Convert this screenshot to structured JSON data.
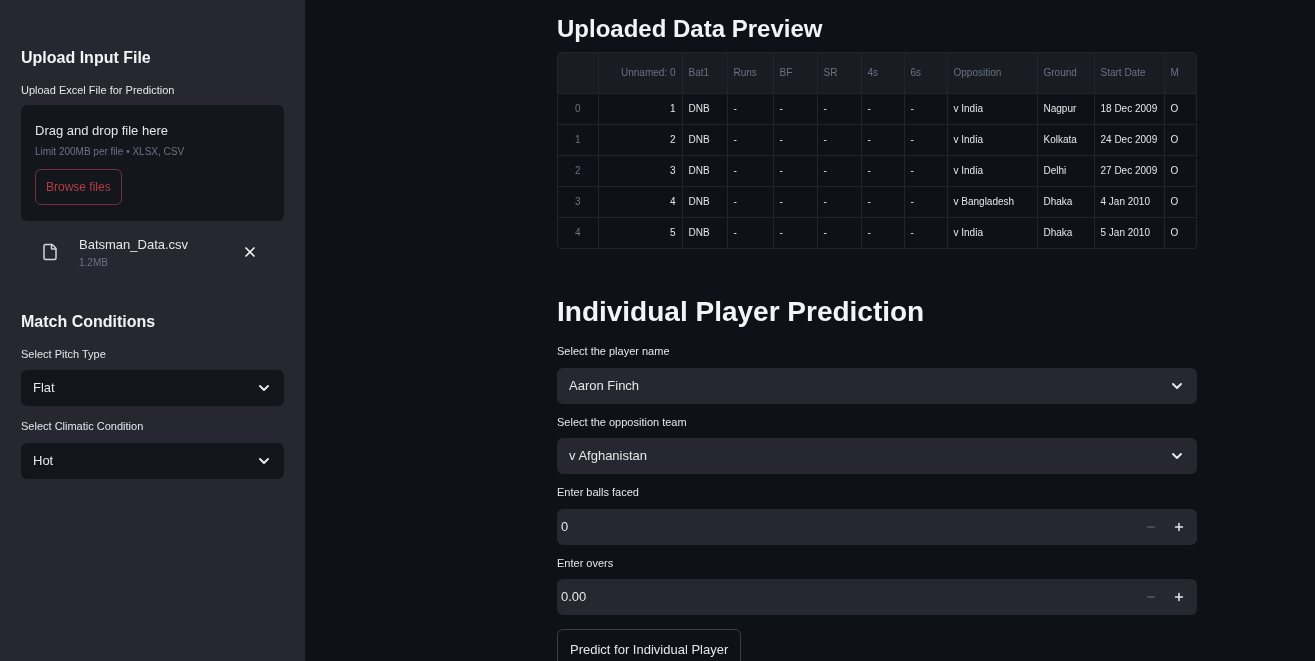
{
  "sidebar": {
    "upload_heading": "Upload Input File",
    "upload_label": "Upload Excel File for Prediction",
    "dropzone": {
      "title": "Drag and drop file here",
      "hint": "Limit 200MB per file • XLSX, CSV",
      "button": "Browse files"
    },
    "file": {
      "name": "Batsman_Data.csv",
      "size": "1.2MB"
    },
    "conditions_heading": "Match Conditions",
    "selects": [
      {
        "label": "Select Pitch Type",
        "value": "Flat"
      },
      {
        "label": "Select Climatic Condition",
        "value": "Hot"
      }
    ]
  },
  "preview": {
    "heading": "Uploaded Data Preview",
    "table": {
      "columns": [
        "",
        "Unnamed: 0",
        "Bat1",
        "Runs",
        "BF",
        "SR",
        "4s",
        "6s",
        "Opposition",
        "Ground",
        "Start Date",
        "M"
      ],
      "rows": [
        [
          "0",
          "1",
          "DNB",
          "-",
          "-",
          "-",
          "-",
          "-",
          "v India",
          "Nagpur",
          "18 Dec 2009",
          "O"
        ],
        [
          "1",
          "2",
          "DNB",
          "-",
          "-",
          "-",
          "-",
          "-",
          "v India",
          "Kolkata",
          "24 Dec 2009",
          "O"
        ],
        [
          "2",
          "3",
          "DNB",
          "-",
          "-",
          "-",
          "-",
          "-",
          "v India",
          "Delhi",
          "27 Dec 2009",
          "O"
        ],
        [
          "3",
          "4",
          "DNB",
          "-",
          "-",
          "-",
          "-",
          "-",
          "v Bangladesh",
          "Dhaka",
          "4 Jan 2010",
          "O"
        ],
        [
          "4",
          "5",
          "DNB",
          "-",
          "-",
          "-",
          "-",
          "-",
          "v India",
          "Dhaka",
          "5 Jan 2010",
          "O"
        ]
      ]
    }
  },
  "prediction": {
    "heading": "Individual Player Prediction",
    "fields": [
      {
        "kind": "select",
        "label": "Select the player name",
        "value": "Aaron Finch"
      },
      {
        "kind": "select",
        "label": "Select the opposition team",
        "value": "v Afghanistan"
      },
      {
        "kind": "number",
        "label": "Enter balls faced",
        "value": "0"
      },
      {
        "kind": "number",
        "label": "Enter overs",
        "value": "0.00"
      }
    ],
    "button": "Predict for Individual Player"
  }
}
